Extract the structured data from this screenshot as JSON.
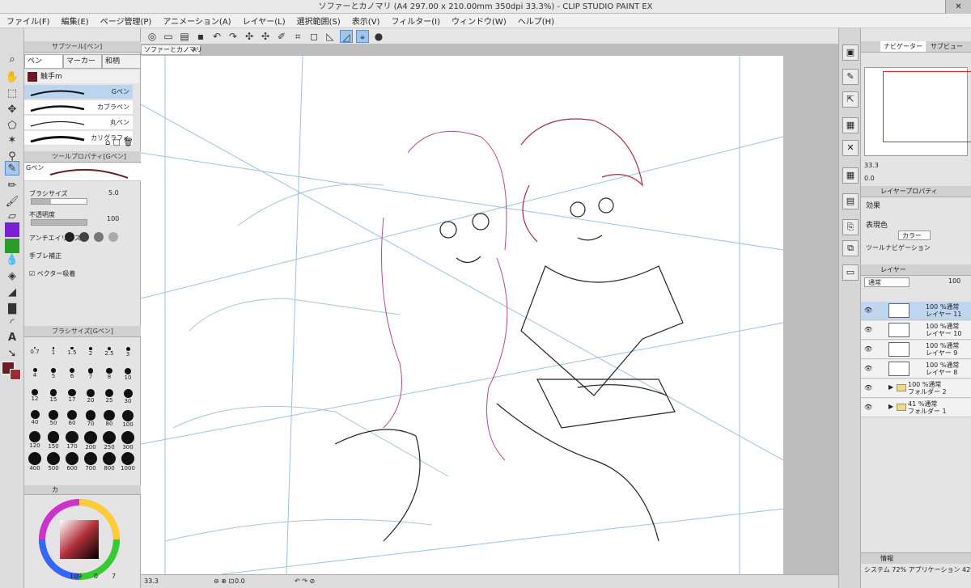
{
  "window": {
    "title": "ソファーとカノマリ (A4 297.00 x 210.00mm 350dpi 33.3%) - CLIP STUDIO PAINT EX",
    "close": "✕"
  },
  "menu": [
    "ファイル(F)",
    "編集(E)",
    "ページ管理(P)",
    "アニメーション(A)",
    "レイヤー(L)",
    "選択範囲(S)",
    "表示(V)",
    "フィルター(I)",
    "ウィンドウ(W)",
    "ヘルプ(H)"
  ],
  "left_panel": {
    "subtool_title": "サブツール[ペン]",
    "subtool_tabs": [
      "ペン",
      "マーカー",
      "和柄"
    ],
    "group": "触手m",
    "pens": [
      "Gペン",
      "カブラペン",
      "丸ペン",
      "カリグラフィ"
    ],
    "tool_property_title": "ツールプロパティ[Gペン]",
    "tool_name": "Gペン",
    "brush_size_label": "ブラシサイズ",
    "brush_size_value": "5.0",
    "brush_size_fraction": 0.35,
    "opacity_label": "不透明度",
    "opacity_value": "100",
    "opacity_fraction": 1.0,
    "antialias_label": "アンチエイリアス",
    "stabilization_label": "手ブレ補正",
    "vector_label": "ベクター吸着",
    "brush_size_panel_title": "ブラシサイズ[Gペン]",
    "brush_sizes": [
      "0.7",
      "1",
      "1.5",
      "2",
      "2.5",
      "3",
      "4",
      "5",
      "6",
      "7",
      "8",
      "10",
      "12",
      "15",
      "17",
      "20",
      "25",
      "30",
      "40",
      "50",
      "60",
      "70",
      "80",
      "100",
      "120",
      "150",
      "170",
      "200",
      "250",
      "300",
      "400",
      "500",
      "600",
      "700",
      "800",
      "1000"
    ],
    "color_tab": "カ",
    "color_values": [
      "109",
      "0",
      "7"
    ],
    "main_color": "#6b1b24"
  },
  "canvas": {
    "doc_tab": "ソファーとカノマリ",
    "doc_tab_close": "×"
  },
  "status": {
    "zoom": "33.3",
    "angle": "0.0"
  },
  "right_panel": {
    "navigator_tabs": [
      "ナビゲーター",
      "サブビュー"
    ],
    "nav_zoom": "33.3",
    "nav_angle": "0.0",
    "layer_property_tabs": [
      "レイヤープロパティ"
    ],
    "effect_label": "効果",
    "color_label": "表現色",
    "color_mode": "カラー",
    "tool_nav_label": "ツールナビゲーション",
    "layer_tab": "レイヤー",
    "blend_mode": "通常",
    "opacity": "100",
    "layers": [
      {
        "line1": "100 %通常",
        "line2": "レイヤー 11",
        "selected": true
      },
      {
        "line1": "100 %通常",
        "line2": "レイヤー 10",
        "selected": false
      },
      {
        "line1": "100 %通常",
        "line2": "レイヤー 9",
        "selected": false
      },
      {
        "line1": "100 %通常",
        "line2": "レイヤー 8",
        "selected": false
      }
    ],
    "folders": [
      {
        "line1": "100 %通常",
        "line2": "フォルダー 2"
      },
      {
        "line1": "41 %通常",
        "line2": "フォルダー 1"
      }
    ],
    "info_tab": "情報",
    "memory": "システム 72%  アプリケーション 42%"
  }
}
